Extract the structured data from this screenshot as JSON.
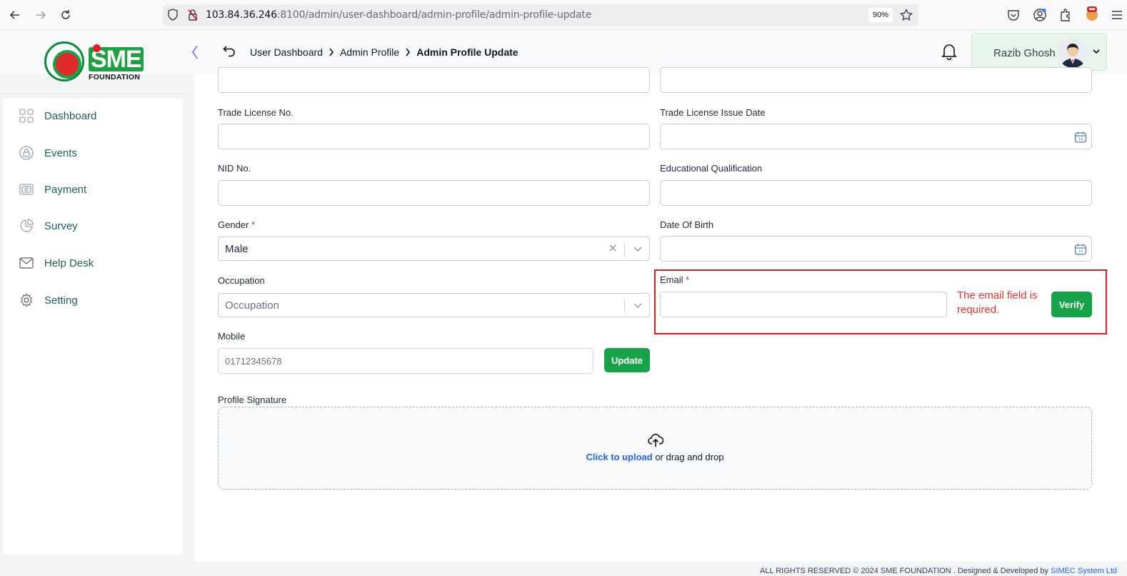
{
  "browser": {
    "url_host": "103.84.36.246",
    "url_rest": ":8100/admin/user-dashboard/admin-profile/admin-profile-update",
    "zoom": "90%"
  },
  "brand": {
    "logo_sme": "SME",
    "logo_foundation": "FOUNDATION",
    "accent": "#17a34a",
    "error": "#e3342f"
  },
  "header": {
    "breadcrumb": [
      "User Dashboard",
      "Admin Profile",
      "Admin Profile Update"
    ],
    "user_name": "Razib Ghosh"
  },
  "sidebar": {
    "items": [
      {
        "label": "Dashboard",
        "icon": "grid-icon"
      },
      {
        "label": "Events",
        "icon": "lock-icon"
      },
      {
        "label": "Payment",
        "icon": "wallet-icon"
      },
      {
        "label": "Survey",
        "icon": "pie-chart-icon"
      },
      {
        "label": "Help Desk",
        "icon": "mail-icon"
      },
      {
        "label": "Setting",
        "icon": "gear-icon"
      }
    ]
  },
  "form": {
    "trade_license_no": {
      "label": "Trade License No.",
      "value": ""
    },
    "trade_license_issue_date": {
      "label": "Trade License Issue Date",
      "value": ""
    },
    "nid_no": {
      "label": "NID No.",
      "value": ""
    },
    "educational_qualification": {
      "label": "Educational Qualification",
      "value": ""
    },
    "gender": {
      "label": "Gender",
      "required": "*",
      "value": "Male"
    },
    "date_of_birth": {
      "label": "Date Of Birth",
      "value": ""
    },
    "occupation": {
      "label": "Occupation",
      "placeholder": "Occupation"
    },
    "email": {
      "label": "Email",
      "required": "*",
      "value": "",
      "error": "The email field is required.",
      "verify_label": "Verify"
    },
    "mobile": {
      "label": "Mobile",
      "placeholder": "01712345678",
      "update_label": "Update"
    },
    "profile_signature": {
      "label": "Profile Signature",
      "upload_link": "Click to upload",
      "upload_rest": "or drag and drop"
    }
  },
  "footer": {
    "text": "ALL RIGHTS RESERVED © 2024 SME FOUNDATION . Designed & Developed by",
    "brand": "SIMEC System Ltd"
  }
}
